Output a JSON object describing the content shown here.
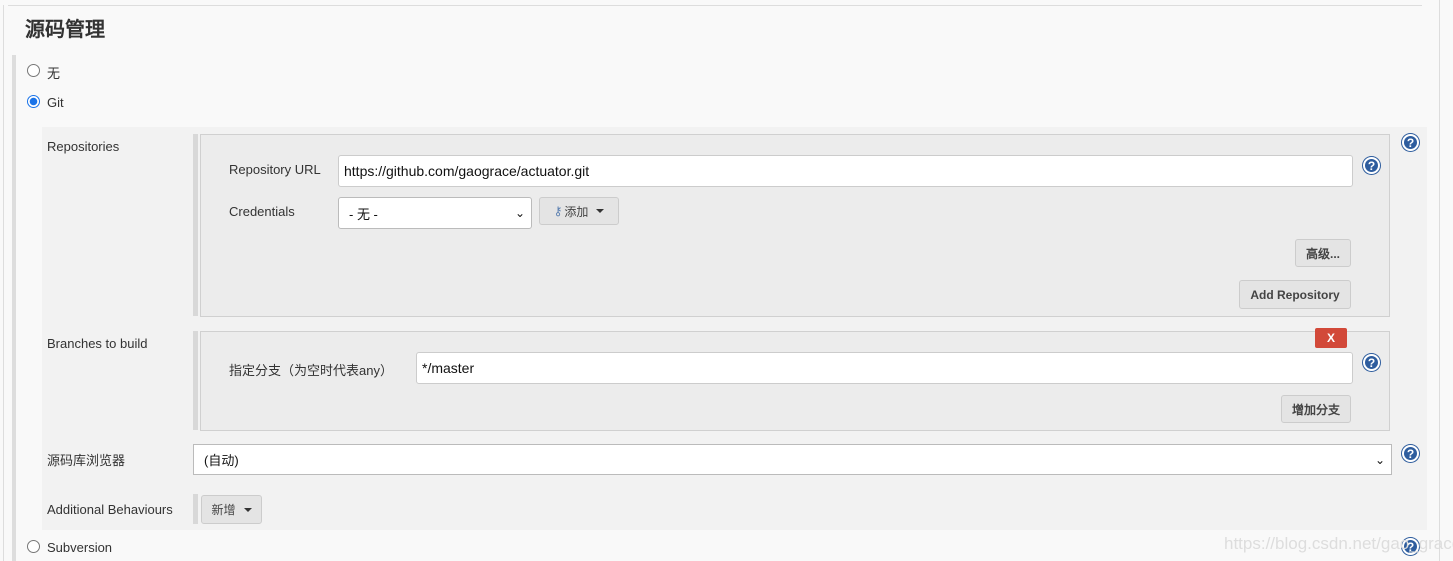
{
  "section_title": "源码管理",
  "scm_options": {
    "none": "无",
    "git": "Git",
    "subversion": "Subversion"
  },
  "selected_scm": "Git",
  "repositories": {
    "label": "Repositories",
    "url_label": "Repository URL",
    "url_value": "https://github.com/gaograce/actuator.git",
    "credentials_label": "Credentials",
    "credentials_value": "- 无 -",
    "add_label": "添加",
    "advanced_label": "高级...",
    "add_repository_label": "Add Repository"
  },
  "branches": {
    "label": "Branches to build",
    "delete_label": "X",
    "branch_label": "指定分支（为空时代表any）",
    "branch_value": "*/master",
    "add_branch_label": "增加分支"
  },
  "browser": {
    "label": "源码库浏览器",
    "value": "(自动)"
  },
  "behaviours": {
    "label": "Additional Behaviours",
    "add_label": "新增"
  },
  "help_glyph": "?",
  "watermark": "https://blog.csdn.net/gao_grace",
  "colors": {
    "accent": "#1a73e8",
    "delete": "#d24939",
    "help": "#2e5d9e"
  }
}
